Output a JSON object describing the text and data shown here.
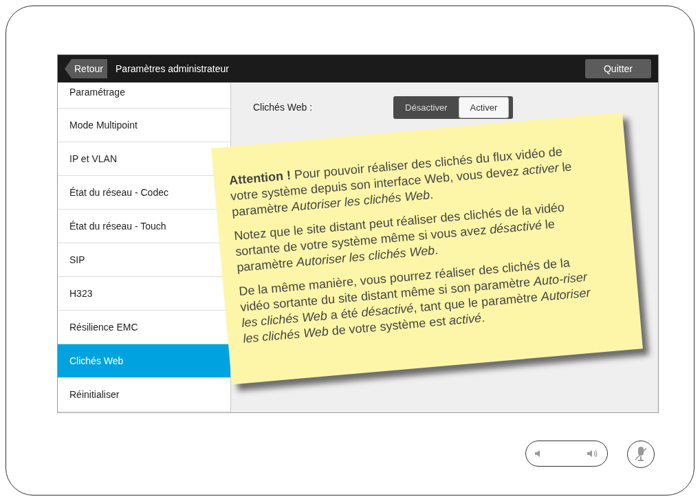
{
  "header": {
    "back": "Retour",
    "title": "Paramètres administrateur",
    "quit": "Quitter"
  },
  "sidebar": {
    "items": [
      {
        "label": "Paramétrage",
        "selected": false
      },
      {
        "label": "Mode Multipoint",
        "selected": false
      },
      {
        "label": "IP et VLAN",
        "selected": false
      },
      {
        "label": "État du réseau - Codec",
        "selected": false
      },
      {
        "label": "État du réseau - Touch",
        "selected": false
      },
      {
        "label": "SIP",
        "selected": false
      },
      {
        "label": "H323",
        "selected": false
      },
      {
        "label": "Résilience EMC",
        "selected": false
      },
      {
        "label": "Clichés Web",
        "selected": true
      },
      {
        "label": "Réinitialiser",
        "selected": false
      }
    ]
  },
  "setting": {
    "label": "Clichés Web :",
    "options": [
      {
        "label": "Désactiver",
        "selected": false
      },
      {
        "label": "Activer",
        "selected": true
      }
    ]
  },
  "note": {
    "paragraphs": [
      "**Attention !** Pour pouvoir réaliser des clichés du flux vidéo de votre système depuis son interface Web, vous devez *activer* le paramètre *Autoriser les clichés Web*.",
      "Notez que le site distant peut réaliser des clichés de la vidéo sortante de votre système même si vous avez *désactivé* le paramètre *Autoriser les clichés Web*.",
      "De la même manière, vous pourrez réaliser des clichés de la vidéo sortante du site distant même si son paramètre *Auto-riser les clichés Web* a été *désactivé*, tant que le paramètre *Autoriser les clichés Web* de votre système est *activé*."
    ]
  },
  "footer": {
    "mic_muted": true
  }
}
